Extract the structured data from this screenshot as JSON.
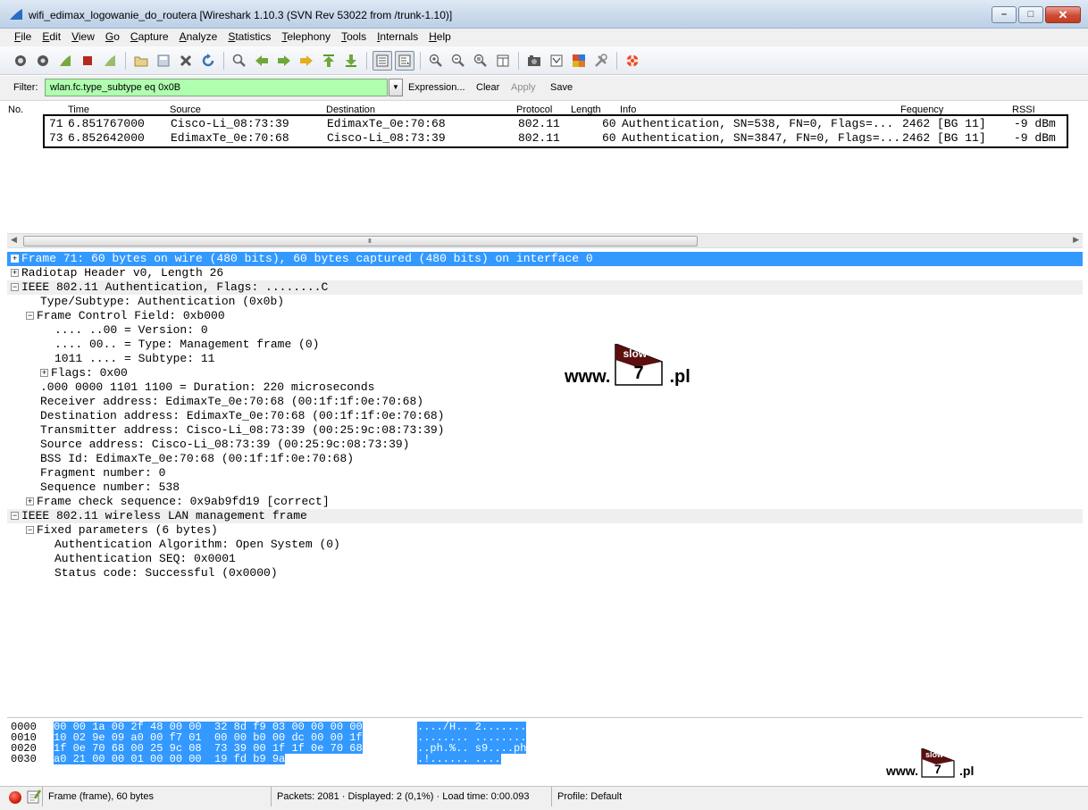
{
  "window": {
    "title": "wifi_edimax_logowanie_do_routera   [Wireshark 1.10.3  (SVN Rev 53022 from /trunk-1.10)]",
    "min": "–",
    "max": "□",
    "close": "✕"
  },
  "menu": [
    "File",
    "Edit",
    "View",
    "Go",
    "Capture",
    "Analyze",
    "Statistics",
    "Telephony",
    "Tools",
    "Internals",
    "Help"
  ],
  "filter": {
    "label": "Filter:",
    "value": "wlan.fc.type_subtype eq 0x0B",
    "expression": "Expression...",
    "clear": "Clear",
    "apply": "Apply",
    "save": "Save"
  },
  "packet_list": {
    "columns": [
      "No.",
      "Time",
      "Source",
      "Destination",
      "Protocol",
      "Length",
      "Info",
      "Fequency",
      "RSSI"
    ],
    "rows": [
      {
        "no": "71",
        "time": "6.851767000",
        "src": "Cisco-Li_08:73:39",
        "dst": "EdimaxTe_0e:70:68",
        "proto": "802.11",
        "len": "60",
        "info": "Authentication, SN=538, FN=0, Flags=...",
        "freq": "2462 [BG 11]",
        "rssi": "-9 dBm"
      },
      {
        "no": "73",
        "time": "6.852642000",
        "src": "EdimaxTe_0e:70:68",
        "dst": "Cisco-Li_08:73:39",
        "proto": "802.11",
        "len": "60",
        "info": "Authentication, SN=3847, FN=0, Flags=...",
        "freq": "2462 [BG 11]",
        "rssi": "-9 dBm"
      }
    ]
  },
  "scroll_grip": "III",
  "details": [
    {
      "toggle": "+",
      "text": "Frame 71: 60 bytes on wire (480 bits), 60 bytes captured (480 bits) on interface 0"
    },
    {
      "toggle": "+",
      "text": "Radiotap Header v0, Length 26"
    },
    {
      "toggle": "−",
      "text": "IEEE 802.11 Authentication, Flags: ........C"
    },
    {
      "toggle": "",
      "text": "Type/Subtype: Authentication (0x0b)"
    },
    {
      "toggle": "−",
      "text": "Frame Control Field: 0xb000"
    },
    {
      "toggle": "",
      "text": ".... ..00 = Version: 0"
    },
    {
      "toggle": "",
      "text": ".... 00.. = Type: Management frame (0)"
    },
    {
      "toggle": "",
      "text": "1011 .... = Subtype: 11"
    },
    {
      "toggle": "+",
      "text": "Flags: 0x00"
    },
    {
      "toggle": "",
      "text": ".000 0000 1101 1100 = Duration: 220 microseconds"
    },
    {
      "toggle": "",
      "text": "Receiver address: EdimaxTe_0e:70:68 (00:1f:1f:0e:70:68)"
    },
    {
      "toggle": "",
      "text": "Destination address: EdimaxTe_0e:70:68 (00:1f:1f:0e:70:68)"
    },
    {
      "toggle": "",
      "text": "Transmitter address: Cisco-Li_08:73:39 (00:25:9c:08:73:39)"
    },
    {
      "toggle": "",
      "text": "Source address: Cisco-Li_08:73:39 (00:25:9c:08:73:39)"
    },
    {
      "toggle": "",
      "text": "BSS Id: EdimaxTe_0e:70:68 (00:1f:1f:0e:70:68)"
    },
    {
      "toggle": "",
      "text": "Fragment number: 0"
    },
    {
      "toggle": "",
      "text": "Sequence number: 538"
    },
    {
      "toggle": "+",
      "text": "Frame check sequence: 0x9ab9fd19 [correct]"
    },
    {
      "toggle": "−",
      "text": "IEEE 802.11 wireless LAN management frame"
    },
    {
      "toggle": "−",
      "text": "Fixed parameters (6 bytes)"
    },
    {
      "toggle": "",
      "text": "Authentication Algorithm: Open System (0)"
    },
    {
      "toggle": "",
      "text": "Authentication SEQ: 0x0001"
    },
    {
      "toggle": "",
      "text": "Status code: Successful (0x0000)"
    }
  ],
  "hex": [
    {
      "offset": "0000",
      "bytes": "00 00 1a 00 2f 48 00 00  32 8d f9 03 00 00 00 00",
      "ascii": "..../H.. 2......."
    },
    {
      "offset": "0010",
      "bytes": "10 02 9e 09 a0 00 f7 01  00 00 b0 00 dc 00 00 1f",
      "ascii": "........ ........"
    },
    {
      "offset": "0020",
      "bytes": "1f 0e 70 68 00 25 9c 08  73 39 00 1f 1f 0e 70 68",
      "ascii": "..ph.%.. s9....ph"
    },
    {
      "offset": "0030",
      "bytes": "a0 21 00 00 01 00 00 00  19 fd b9 9a",
      "ascii": ".!...... ...."
    }
  ],
  "logo": {
    "www": "www.",
    "slow": "slow",
    "seven": "7",
    "pl": ".pl"
  },
  "status": {
    "frame": "Frame (frame), 60 bytes",
    "packets": "Packets: 2081 · Displayed: 2 (0,1%) · Load time: 0:00.093",
    "profile": "Profile: Default"
  },
  "colors": {
    "selection": "#3399ff",
    "filter_ok": "#afffaf",
    "logo_dark": "#5b0f0f"
  }
}
